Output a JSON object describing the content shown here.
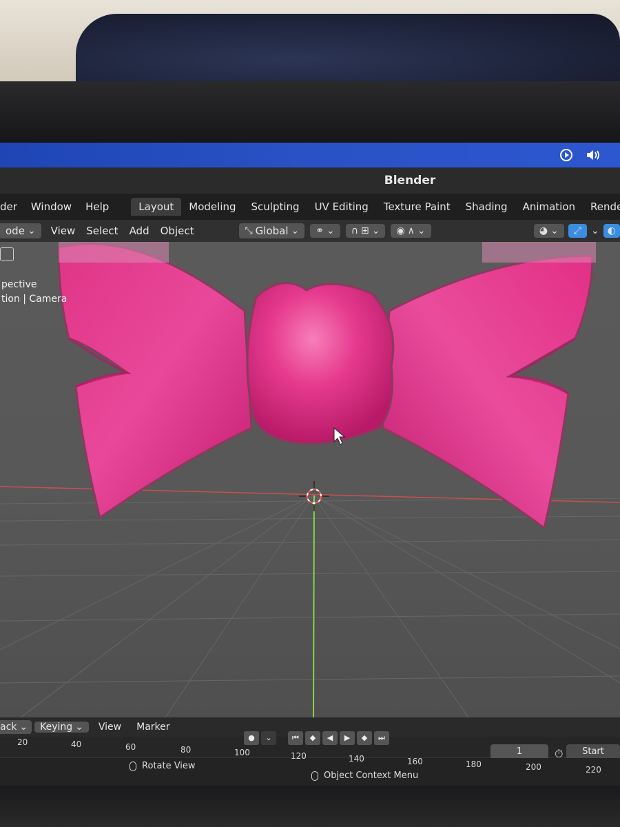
{
  "app": {
    "title": "Blender"
  },
  "menu": [
    "der",
    "Window",
    "Help"
  ],
  "workspaces": [
    "Layout",
    "Modeling",
    "Sculpting",
    "UV Editing",
    "Texture Paint",
    "Shading",
    "Animation",
    "Rendering"
  ],
  "active_workspace": "Layout",
  "header": {
    "mode": "ode",
    "items": [
      "View",
      "Select",
      "Add",
      "Object"
    ],
    "transform_orientation": "Global"
  },
  "viewport": {
    "overlay_line1": "pective",
    "overlay_line2": "tion | Camera",
    "object_color": "#e0257f"
  },
  "timeline": {
    "header_items": [
      "ack",
      "Keying",
      "View",
      "Marker"
    ],
    "current_frame": "1",
    "start_label": "Start",
    "ticks": [
      "20",
      "40",
      "60",
      "80",
      "100",
      "120",
      "140",
      "160",
      "180",
      "200",
      "220"
    ]
  },
  "status": {
    "left": "Rotate View",
    "center": "Object Context Menu"
  },
  "colors": {
    "os_bar": "#2a52c6",
    "accent": "#3a8de0",
    "x_axis": "#c8504f",
    "y_axis": "#8ad14a"
  }
}
